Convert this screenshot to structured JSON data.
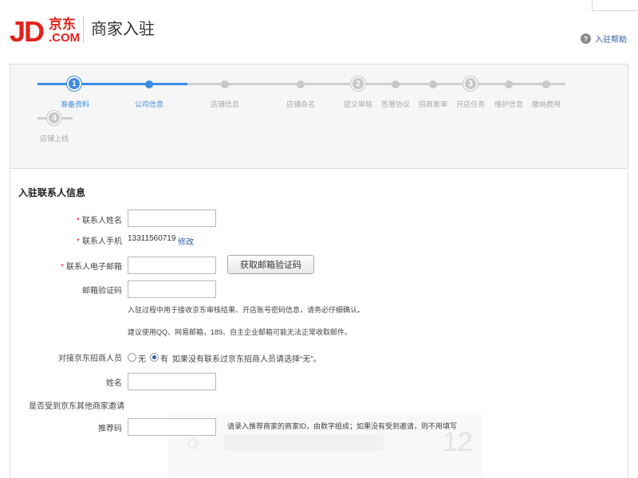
{
  "header": {
    "logo_jd": "JD",
    "logo_cn": "京东",
    "logo_com": ".COM",
    "title": "商家入驻",
    "help_label": "入驻帮助",
    "help_icon": "question-icon"
  },
  "progress": {
    "steps": [
      {
        "label": "准备资料",
        "number": "1",
        "active": true
      },
      {
        "label": "公司信息",
        "active": true
      },
      {
        "label": "店铺信息",
        "active": false
      },
      {
        "label": "店铺命名",
        "active": false
      },
      {
        "label": "提交审核",
        "number": "2",
        "active": false
      },
      {
        "label": "签署协议",
        "active": false
      },
      {
        "label": "招商复审",
        "active": false
      },
      {
        "label": "开店任务",
        "number": "3",
        "active": false
      },
      {
        "label": "维护信息",
        "active": false
      },
      {
        "label": "缴纳费用",
        "active": false
      },
      {
        "label": "店铺上线",
        "number": "4",
        "active": false
      }
    ],
    "colors": {
      "active": "#3d8ce3",
      "inactive": "#c8c8c8"
    }
  },
  "form": {
    "section_title": "入驻联系人信息",
    "contact_name_label": "联系人姓名",
    "contact_phone_label": "联系人手机",
    "contact_phone_value": "13311560719",
    "edit_label": "修改",
    "email_label": "联系人电子邮箱",
    "get_code_button": "获取邮箱验证码",
    "email_code_label": "邮箱验证码",
    "hint_1": "入驻过程中用于接收京东审核结果、开店账号密码信息，请务必仔细确认。",
    "hint_2": "建议使用QQ、网易邮箱，189、自主企业邮箱可能无法正常收取邮件。",
    "recruiter_label": "对接京东招商人员",
    "radio_none": "无",
    "radio_yes": "有",
    "radio_hint": "如果没有联系过京东招商人员请选择“无”。",
    "name_label": "姓名",
    "invited_label": "是否受到京东其他商家邀请",
    "referral_label": "推荐码",
    "referral_hint": "请录入推荐商家的商家ID，由数字组成；如果没有受到邀请，则不用填写",
    "required_mark": "*",
    "overlay_number": "12"
  }
}
